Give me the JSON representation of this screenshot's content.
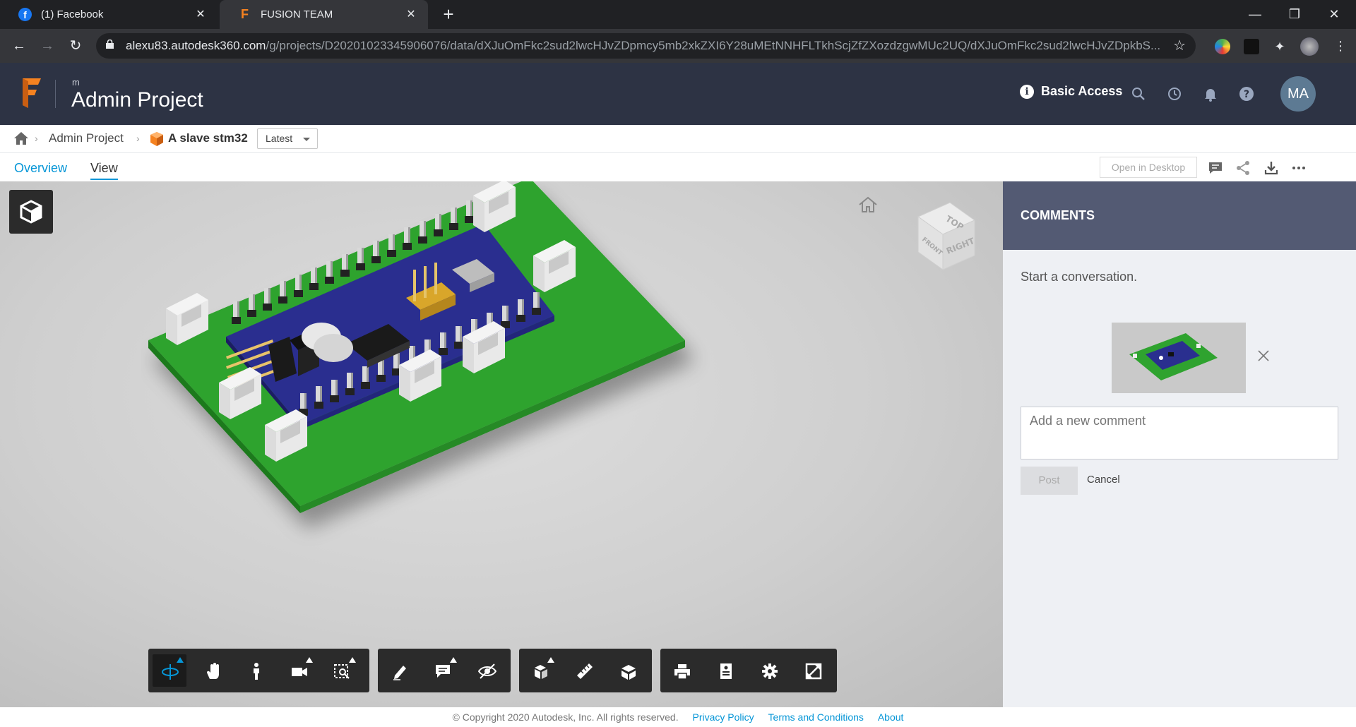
{
  "browser": {
    "tabs": [
      {
        "title": "(1) Facebook",
        "favicon": "facebook-icon"
      },
      {
        "title": "FUSION TEAM",
        "favicon": "fusion-icon",
        "active": true
      }
    ],
    "url_host": "alexu83.autodesk360.com",
    "url_path": "/g/projects/D20201023345906076/data/dXJuOmFkc2sud2lwcHJvZDpmcy5mb2xkZXI6Y28uMEtNNHFLTkhScjZfZXozdzgwMUc2UQ/dXJuOmFkc2sud2lwcHJvZDpkbS..."
  },
  "header": {
    "hub_label": "m",
    "project_title": "Admin Project",
    "access_label": "Basic Access",
    "avatar_initials": "MA"
  },
  "breadcrumb": {
    "project": "Admin Project",
    "item": "A slave stm32",
    "version": "Latest"
  },
  "tabs": [
    {
      "label": "Overview"
    },
    {
      "label": "View",
      "active": true
    }
  ],
  "actions": {
    "open_desktop": "Open in Desktop"
  },
  "viewcube": {
    "top": "TOP",
    "front": "FRONT",
    "right": "RIGHT"
  },
  "toolbar": {
    "groups": [
      [
        "orbit-icon",
        "pan-icon",
        "walk-icon",
        "camera-icon",
        "fit-icon"
      ],
      [
        "markup-icon",
        "comment-icon",
        "hide-icon"
      ],
      [
        "explode-icon",
        "measure-icon",
        "section-icon"
      ],
      [
        "print-icon",
        "properties-icon",
        "settings-icon",
        "fullscreen-icon"
      ]
    ]
  },
  "comments": {
    "title": "COMMENTS",
    "start_text": "Start a conversation.",
    "placeholder": "Add a new comment",
    "post_label": "Post",
    "cancel_label": "Cancel"
  },
  "footer": {
    "copyright": "© Copyright 2020 Autodesk, Inc. All rights reserved.",
    "privacy": "Privacy Policy",
    "terms": "Terms and Conditions",
    "about": "About"
  }
}
